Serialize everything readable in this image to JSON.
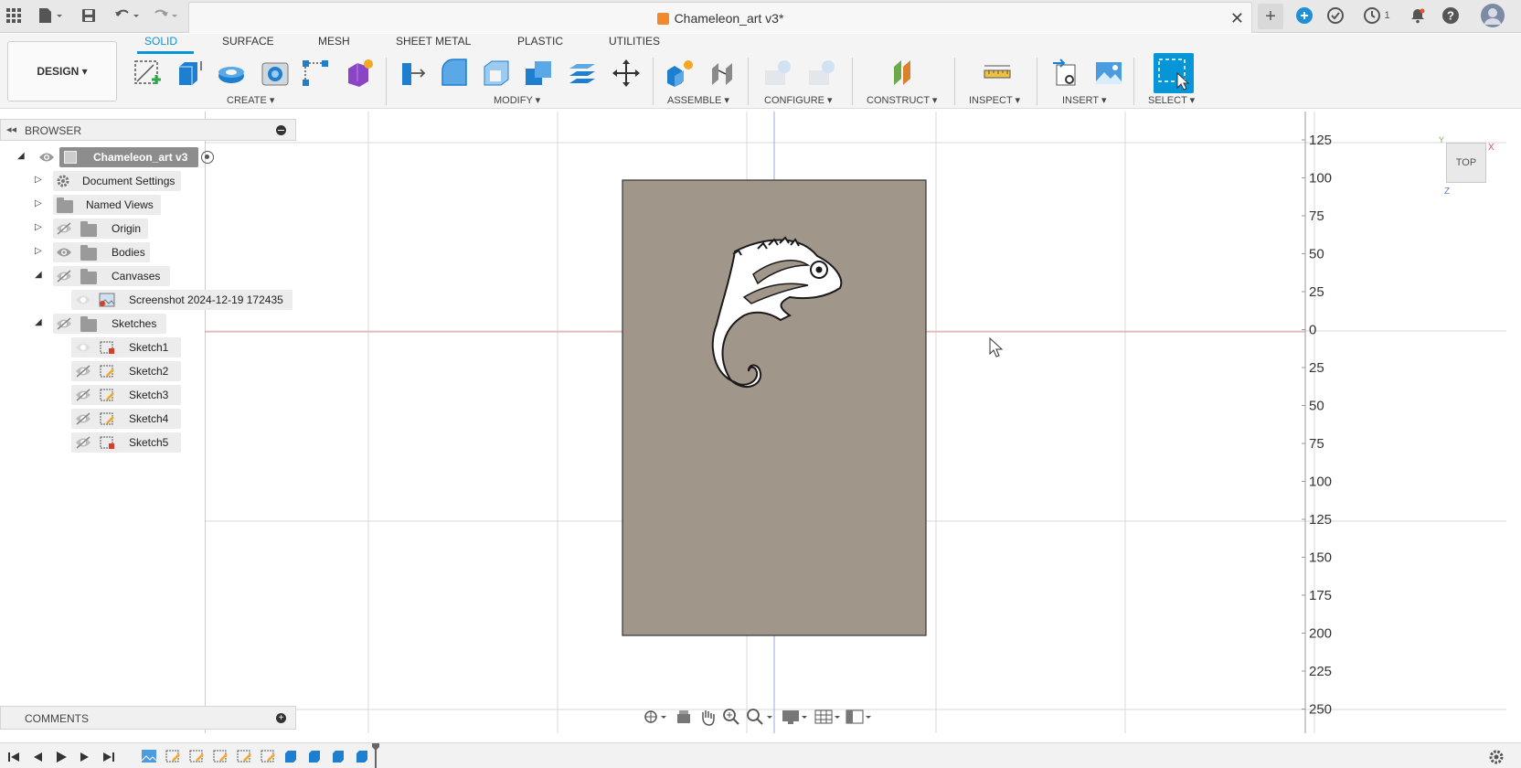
{
  "window": {
    "title": "Chameleon_art v3*",
    "notification_count": "1"
  },
  "toolbar": {
    "workspace_label": "DESIGN ▾",
    "tabs": [
      {
        "label": "SOLID",
        "active": true
      },
      {
        "label": "SURFACE",
        "active": false
      },
      {
        "label": "MESH",
        "active": false
      },
      {
        "label": "SHEET METAL",
        "active": false
      },
      {
        "label": "PLASTIC",
        "active": false
      },
      {
        "label": "UTILITIES",
        "active": false
      }
    ],
    "groups": {
      "create": "CREATE ▾",
      "modify": "MODIFY ▾",
      "assemble": "ASSEMBLE ▾",
      "configure": "CONFIGURE ▾",
      "construct": "CONSTRUCT ▾",
      "inspect": "INSPECT ▾",
      "insert": "INSERT ▾",
      "select": "SELECT ▾"
    }
  },
  "browser": {
    "header": "BROWSER",
    "root": "Chameleon_art v3",
    "items": [
      {
        "label": "Document Settings",
        "icon": "gear-icon"
      },
      {
        "label": "Named Views",
        "icon": "folder-icon"
      },
      {
        "label": "Origin",
        "icon": "folder-icon"
      },
      {
        "label": "Bodies",
        "icon": "folder-icon"
      },
      {
        "label": "Canvases",
        "icon": "folder-icon"
      },
      {
        "label": "Screenshot 2024-12-19 172435",
        "icon": "canvas-image-icon"
      },
      {
        "label": "Sketches",
        "icon": "folder-icon"
      },
      {
        "label": "Sketch1",
        "icon": "sketch-icon"
      },
      {
        "label": "Sketch2",
        "icon": "sketch-icon"
      },
      {
        "label": "Sketch3",
        "icon": "sketch-icon"
      },
      {
        "label": "Sketch4",
        "icon": "sketch-icon"
      },
      {
        "label": "Sketch5",
        "icon": "sketch-icon"
      }
    ]
  },
  "comments": {
    "label": "COMMENTS"
  },
  "viewport": {
    "ruler_ticks": [
      "125",
      "100",
      "75",
      "50",
      "25",
      "0",
      "25",
      "50",
      "75",
      "100",
      "125",
      "150",
      "175",
      "200",
      "225",
      "250"
    ],
    "viewcube_face": "TOP",
    "axis_labels": {
      "x": "X",
      "y": "Y",
      "z": "Z"
    },
    "colors": {
      "panel": "#a0968a",
      "grid": "#d9d9d9",
      "x_axis": "#e8a0a0",
      "y_axis": "#9aa8e0",
      "accent": "#0696d7"
    }
  }
}
